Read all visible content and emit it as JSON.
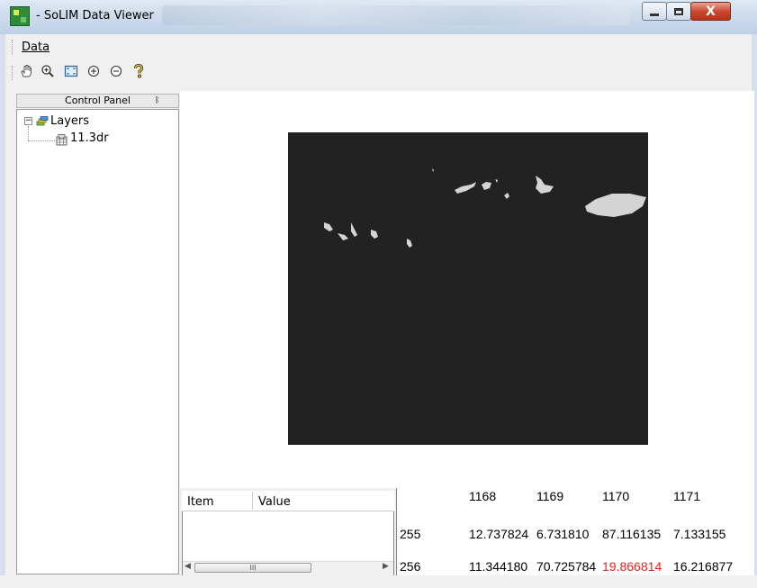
{
  "window": {
    "title": "- SoLIM Data Viewer",
    "controls": {
      "minimize": "minimize",
      "maximize": "maximize",
      "close": "X"
    }
  },
  "menu": {
    "items": [
      {
        "label": "Data"
      }
    ]
  },
  "toolbar": {
    "tools": [
      {
        "name": "pan",
        "glyph": "✋"
      },
      {
        "name": "zoom-in-rect",
        "glyph": "⊕"
      },
      {
        "name": "fit-to-view",
        "glyph": "⛶"
      },
      {
        "name": "zoom-in",
        "glyph": "⊕"
      },
      {
        "name": "zoom-out",
        "glyph": "⊖"
      },
      {
        "name": "help",
        "glyph": "?"
      }
    ]
  },
  "control_panel": {
    "title": "Control Panel",
    "pin": "ᛒ",
    "tree": {
      "toggle": "−",
      "root": "Layers",
      "children": [
        {
          "label": "11.3dr"
        }
      ]
    }
  },
  "property_grid": {
    "columns": [
      "Item",
      "Value"
    ],
    "scroll": {
      "left": "◀",
      "right": "▶",
      "thumb": "III"
    }
  },
  "data_table": {
    "columns": [
      "1168",
      "1169",
      "1170",
      "1171"
    ],
    "rows": [
      {
        "row": "255",
        "cells": [
          "12.737824",
          "6.731810",
          "87.116135",
          "7.133155"
        ]
      },
      {
        "row": "256",
        "cells": [
          "11.344180",
          "70.725784",
          "19.866814",
          "16.216877"
        ]
      }
    ],
    "highlight_color": "#e8231a"
  },
  "raster": {
    "background": "#222222"
  }
}
